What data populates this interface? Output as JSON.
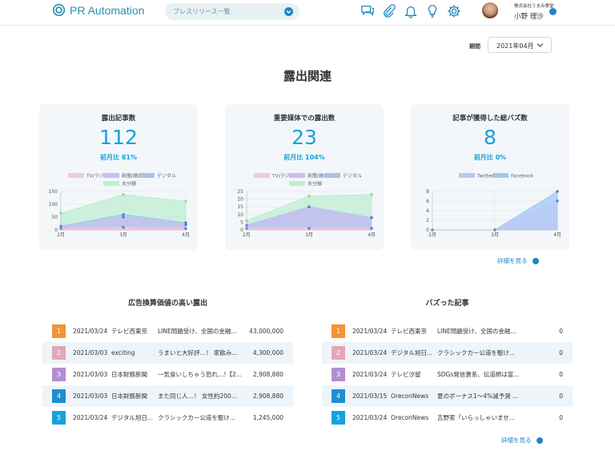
{
  "header": {
    "logo_text": "PR Automation",
    "search_dropdown": "プレスリリース一覧",
    "company": "株式会社うまみ食堂",
    "user_name": "小野 理沙"
  },
  "period": {
    "label": "期間",
    "value": "2021年04月"
  },
  "section_title": "露出関連",
  "cards": [
    {
      "title": "露出記事数",
      "value": "112",
      "sub": "前月比 81%"
    },
    {
      "title": "重要媒体での露出数",
      "value": "23",
      "sub": "前月比 104%"
    },
    {
      "title": "記事が獲得した総バズ数",
      "value": "8",
      "sub": "前月比 0%"
    }
  ],
  "legend_media": [
    "TV/ラジオ",
    "新聞/雑誌",
    "デジタル",
    "未分類"
  ],
  "legend_buzz": [
    "Twitter",
    "Facebook"
  ],
  "colors": {
    "tv": "#f7c6d9",
    "paper": "#c7c0ef",
    "digital": "#a9c2ec",
    "other": "#bfeed0",
    "accent": "#1aa0da",
    "twitter": "#b9c8f7",
    "facebook": "#9dcaf0"
  },
  "chart_data": [
    {
      "type": "area",
      "x": [
        "2月",
        "3月",
        "4月"
      ],
      "ylim": [
        0,
        150
      ],
      "yticks": [
        "0",
        "50",
        "100",
        "150"
      ],
      "series": [
        {
          "name": "TV/ラジオ",
          "values": [
            5,
            10,
            5
          ]
        },
        {
          "name": "新聞/雑誌",
          "values": [
            10,
            50,
            20
          ]
        },
        {
          "name": "デジタル",
          "values": [
            15,
            60,
            28
          ]
        },
        {
          "name": "未分類",
          "values": [
            65,
            138,
            112
          ]
        }
      ]
    },
    {
      "type": "area",
      "x": [
        "2月",
        "3月",
        "4月"
      ],
      "ylim": [
        0,
        25
      ],
      "yticks": [
        "0",
        "5",
        "10",
        "15",
        "20",
        "25"
      ],
      "series": [
        {
          "name": "TV/ラジオ",
          "values": [
            1,
            1,
            1
          ]
        },
        {
          "name": "新聞/雑誌",
          "values": [
            3,
            15,
            8
          ]
        },
        {
          "name": "デジタル",
          "values": [
            3,
            15,
            8
          ]
        },
        {
          "name": "未分類",
          "values": [
            6,
            22,
            23
          ]
        }
      ]
    },
    {
      "type": "area",
      "x": [
        "2月",
        "3月",
        "4月"
      ],
      "ylim": [
        0,
        8
      ],
      "yticks": [
        "0",
        "2",
        "4",
        "6",
        "8"
      ],
      "series": [
        {
          "name": "Twitter",
          "values": [
            0,
            0,
            6
          ]
        },
        {
          "name": "Facebook",
          "values": [
            0,
            0,
            8
          ]
        }
      ]
    }
  ],
  "more_label": "詳細を見る",
  "ad_list": {
    "title": "広告換算価値の高い露出",
    "rows": [
      {
        "rank": "1",
        "date": "2021/03/24",
        "media": "テレビ西東京",
        "text": "LINE問題受け、全国の金融...",
        "value": "43,000,000",
        "color": "#f39433"
      },
      {
        "rank": "2",
        "date": "2021/03/03",
        "media": "exciting",
        "text": "うまいと大好評…！ 家飲み...",
        "value": "4,300,000",
        "color": "#e3a7b8"
      },
      {
        "rank": "3",
        "date": "2021/03/03",
        "media": "日本財務新聞",
        "text": "一気食いしちゃう恐れ…!【2...",
        "value": "2,908,880",
        "color": "#b28fd0"
      },
      {
        "rank": "4",
        "date": "2021/03/03",
        "media": "日本財務新聞",
        "text": "また同じ人…！ 女性約200...",
        "value": "2,908,880",
        "color": "#1d8fcf"
      },
      {
        "rank": "5",
        "date": "2021/03/24",
        "media": "デジタル旭日...",
        "text": "クラシックカー公道を駆け...",
        "value": "1,245,000",
        "color": "#1aa0da"
      }
    ]
  },
  "buzz_list": {
    "title": "バズった記事",
    "rows": [
      {
        "rank": "1",
        "date": "2021/03/24",
        "media": "テレビ西東京",
        "text": "LINE問題受け、全国の金融...",
        "value": "0",
        "color": "#f39433"
      },
      {
        "rank": "2",
        "date": "2021/03/24",
        "media": "デジタル旭日...",
        "text": "クラシックカー公道を駆け...",
        "value": "0",
        "color": "#e3a7b8"
      },
      {
        "rank": "3",
        "date": "2021/03/24",
        "media": "テレビ汐留",
        "text": "SDGs発信褒系、伝道師は富...",
        "value": "0",
        "color": "#b28fd0"
      },
      {
        "rank": "4",
        "date": "2021/03/15",
        "media": "OreconNews",
        "text": "夏のボーナス1〜4%減予測 ...",
        "value": "0",
        "color": "#1d8fcf"
      },
      {
        "rank": "5",
        "date": "2021/03/24",
        "media": "OreconNews",
        "text": "吉野家「いらっしゃいませ...",
        "value": "0",
        "color": "#1aa0da"
      }
    ]
  }
}
